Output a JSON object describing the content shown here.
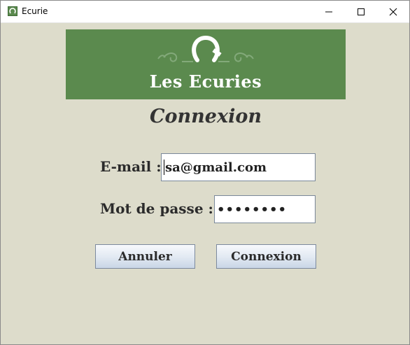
{
  "window": {
    "title": "Ecurie",
    "app_icon": "horseshoe-icon",
    "controls": [
      "minimize-icon",
      "maximize-icon",
      "close-icon"
    ]
  },
  "banner": {
    "title": "Les Ecuries",
    "icon": "horseshoe-icon",
    "background": "#5b8a4e"
  },
  "form": {
    "heading": "Connexion",
    "email_label": "E-mail :",
    "email_value": "sa@gmail.com",
    "password_label": "Mot de passe :",
    "password_value": "••••••••"
  },
  "buttons": {
    "cancel": "Annuler",
    "login": "Connexion"
  },
  "colors": {
    "background": "#dddccb",
    "banner": "#5b8a4e",
    "button_gradient_top": "#f7f9fc",
    "button_gradient_bottom": "#c9d6e6"
  }
}
